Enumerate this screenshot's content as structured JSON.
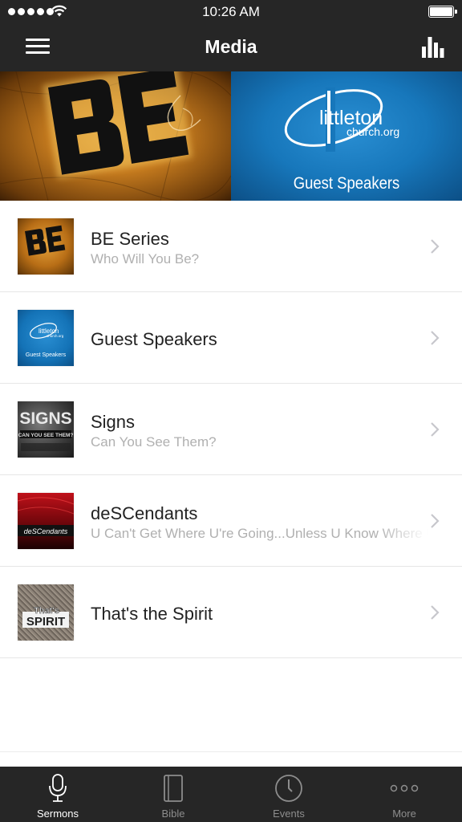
{
  "status_bar": {
    "time": "10:26 AM"
  },
  "nav": {
    "title": "Media"
  },
  "banner": {
    "left_logo_text": "BE",
    "right_brand_line1": "littleton",
    "right_brand_line2": "church.org",
    "right_label": "Guest Speakers"
  },
  "media": [
    {
      "title": "BE Series",
      "subtitle": "Who Will You Be?"
    },
    {
      "title": "Guest Speakers",
      "subtitle": ""
    },
    {
      "title": "Signs",
      "subtitle": "Can You See Them?"
    },
    {
      "title": "deSCendants",
      "subtitle": "U Can't Get Where U're Going...Unless U Know Where U've Been"
    },
    {
      "title": "That's the Spirit",
      "subtitle": ""
    }
  ],
  "thumbs": {
    "be": "BE",
    "guest_line1": "littleton",
    "guest_line2": "church.org",
    "guest_caption": "Guest Speakers",
    "signs_title": "SIGNS",
    "signs_sub": "CAN YOU SEE THEM?",
    "descendants": "deSCendants",
    "spirit_small": "That's",
    "spirit_big": "SPIRIT"
  },
  "tabs": [
    {
      "label": "Sermons",
      "icon": "microphone-icon",
      "active": true
    },
    {
      "label": "Bible",
      "icon": "book-icon",
      "active": false
    },
    {
      "label": "Events",
      "icon": "clock-icon",
      "active": false
    },
    {
      "label": "More",
      "icon": "ellipsis-icon",
      "active": false
    }
  ],
  "colors": {
    "bar_background": "#262626",
    "active_tab": "#ffffff",
    "inactive_tab": "#8d8d8d",
    "subtitle_gray": "#b0b0b0",
    "brand_blue": "#1777bb"
  }
}
